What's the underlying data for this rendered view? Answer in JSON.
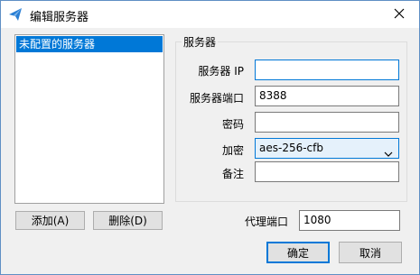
{
  "window": {
    "title": "编辑服务器"
  },
  "server_list": {
    "items": [
      "未配置的服务器"
    ]
  },
  "buttons": {
    "add": "添加(A)",
    "delete": "删除(D)",
    "ok": "确定",
    "cancel": "取消"
  },
  "server_group": {
    "title": "服务器",
    "fields": {
      "ip": {
        "label": "服务器 IP",
        "value": ""
      },
      "port": {
        "label": "服务器端口",
        "value": "8388"
      },
      "password": {
        "label": "密码",
        "value": ""
      },
      "encryption": {
        "label": "加密",
        "value": "aes-256-cfb"
      },
      "remarks": {
        "label": "备注",
        "value": ""
      }
    }
  },
  "proxy_port": {
    "label": "代理端口",
    "value": "1080"
  },
  "icons": {
    "app": "paper-plane-icon",
    "close": "close-icon",
    "dropdown": "chevron-down-icon"
  },
  "colors": {
    "accent": "#0078d7",
    "selection": "#0078d7",
    "window_bg": "#f0f0f0"
  }
}
